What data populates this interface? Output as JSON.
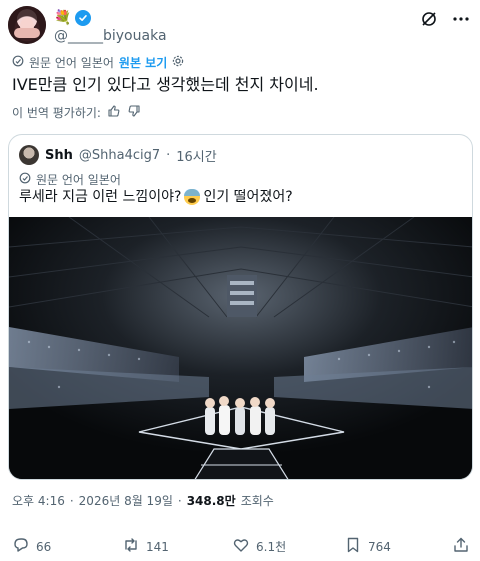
{
  "author": {
    "name_emoji": "💐",
    "handle": "@_____biyouaka",
    "verified": true
  },
  "translation": {
    "label": "원문 언어 일본어",
    "show_original": "원본 보기"
  },
  "tweet": {
    "text": "IVE만큼 인기 있다고 생각했는데 천지 차이네.",
    "rate_translation": "이 번역 평가하기:"
  },
  "quote": {
    "name": "Shh",
    "handle": "@Shha4cig7",
    "separator": "·",
    "time": "16시간",
    "translation_label": "원문 언어 일본어",
    "text_part1": "루세라 지금 이런 느낌이야?",
    "text_part2": "인기 떨어졌어?"
  },
  "meta": {
    "time": "오후 4:16",
    "dot": "·",
    "date": "2026년 8월 19일",
    "views_count": "348.8만",
    "views_label": "조회수"
  },
  "actions": {
    "reply_count": "66",
    "retweet_count": "141",
    "like_count": "6.1천",
    "bookmark_count": "764"
  },
  "colors": {
    "accent": "#1d9bf0",
    "muted": "#536471",
    "text": "#0f1419",
    "border": "#cfd9de"
  }
}
